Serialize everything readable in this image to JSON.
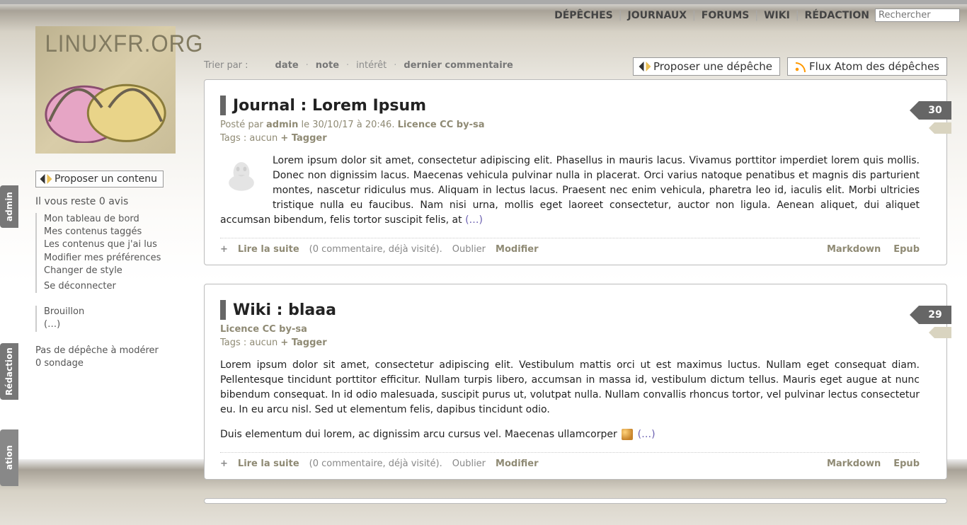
{
  "colors": {
    "accent": "#8f8a74",
    "ribbon": "#666666"
  },
  "topnav": {
    "items": [
      "DÉPÊCHES",
      "JOURNAUX",
      "FORUMS",
      "WIKI",
      "RÉDACTION"
    ],
    "search_placeholder": "Rechercher"
  },
  "logo_text": "LINUXFR.ORG",
  "vtabs": {
    "t1": "admin",
    "t2": "Rédaction",
    "t3": "ation"
  },
  "sidebar": {
    "propose": "Proposer un contenu",
    "block1_title": "Il vous reste 0 avis",
    "block1_items": [
      "Mon tableau de bord",
      "Mes contenus taggés",
      "Les contenus que j'ai lus",
      "Modifier mes préférences",
      "Changer de style",
      "Se déconnecter"
    ],
    "block2_items": [
      "Brouillon",
      "(…)"
    ],
    "block3_items": [
      "Pas de dépêche à modérer",
      "0 sondage"
    ]
  },
  "sort": {
    "label": "Trier par :",
    "items": [
      "date",
      "note",
      "intérêt",
      "dernier commentaire"
    ]
  },
  "top_actions": {
    "propose": "Proposer une dépêche",
    "feed": "Flux Atom des dépêches"
  },
  "cards": [
    {
      "title": "Journal : Lorem Ipsum",
      "meta_pre": "Posté par ",
      "author": "admin",
      "meta_mid": " le 30/10/17 à 20:46. ",
      "licence": "Licence CC by-sa",
      "tags_pre": "Tags : aucun  ",
      "tagger": "Tagger",
      "body": "Lorem ipsum dolor sit amet, consectetur adipiscing elit. Phasellus in mauris lacus. Vivamus porttitor imperdiet lorem quis mollis. Donec non dignissim lacus. Maecenas vehicula pulvinar nulla in placerat. Orci varius natoque penatibus et magnis dis parturient montes, nascetur ridiculus mus. Aliquam in lectus lacus. Praesent nec enim vehicula, pharetra leo id, iaculis elit. Morbi ultricies tristique nulla eu faucibus. Nam nisi urna, mollis eget laoreet consectetur, auctor non ligula. Aenean aliquet, dui aliquet accumsan bibendum, felis tortor suscipit felis, at ",
      "link": "(…)",
      "foot_read": "Lire la suite",
      "foot_info": "(0 commentaire, déjà visité).",
      "foot_forget": "Oublier",
      "foot_edit": "Modifier",
      "md": "Markdown",
      "epub": "Epub",
      "score": "30",
      "has_avatar": true
    },
    {
      "title": "Wiki : blaaa",
      "licence_only": "Licence CC by-sa",
      "tags_pre": "Tags : aucun  ",
      "tagger": "Tagger",
      "body": "Lorem ipsum dolor sit amet, consectetur adipiscing elit. Vestibulum mattis orci ut est maximus luctus. Nullam eget consequat diam. Pellentesque tincidunt porttitor efficitur. Nullam turpis libero, accumsan in massa id, vestibulum dictum tellus. Mauris eget augue at nunc bibendum consequat. In id odio malesuada, suscipit purus ut, volutpat nulla. Nullam convallis rhoncus tortor, vel pulvinar lectus consectetur eu. In eu arcu nisl. Sed ut elementum felis, dapibus tincidunt odio.",
      "body2": "Duis elementum dui lorem, ac dignissim arcu cursus vel. Maecenas ullamcorper ",
      "link": "(…)",
      "foot_read": "Lire la suite",
      "foot_info": "(0 commentaire, déjà visité).",
      "foot_forget": "Oublier",
      "foot_edit": "Modifier",
      "md": "Markdown",
      "epub": "Epub",
      "score": "29",
      "has_avatar": false
    }
  ]
}
